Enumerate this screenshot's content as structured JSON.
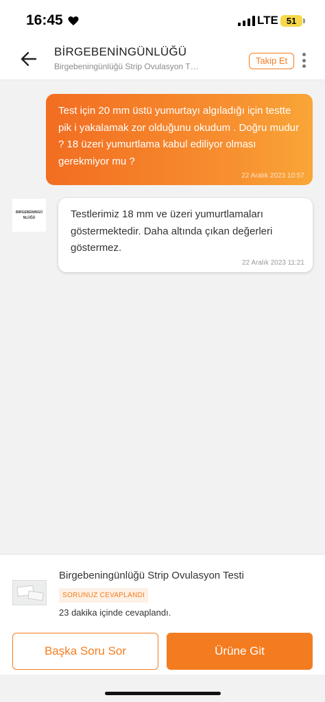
{
  "status_bar": {
    "time": "16:45",
    "network": "LTE",
    "battery": "51",
    "icons": [
      "heart-icon",
      "signal-icon",
      "battery-icon"
    ]
  },
  "header": {
    "title": "BİRGEBENİNGÜNLÜĞÜ",
    "subtitle": "Birgebeningünlüğü Strip Ovulasyon T…",
    "follow_label": "Takip Et",
    "icons": [
      "back-arrow-icon",
      "more-options-icon"
    ]
  },
  "messages": [
    {
      "sender": "user",
      "text": "Test için 20 mm üstü yumurtayı algıladığı için testte pik i yakalamak zor olduğunu okudum . Doğru mudur ? 18 üzeri yumurtlama kabul ediliyor olması gerekmiyor mu ?",
      "time": "22 Aralık 2023 10:57"
    },
    {
      "sender": "brand",
      "avatar_text": "BIRGEBENINGÜ NLÜĞÜ",
      "text": "Testlerimiz 18 mm ve üzeri yumurtlamaları göstermektedir. Daha altında çıkan değerleri göstermez.",
      "time": "22 Aralık 2023 11:21"
    }
  ],
  "product": {
    "name": "Birgebeningünlüğü Strip Ovulasyon Testi",
    "badge": "SORUNUZ CEVAPLANDI",
    "answer_time": "23 dakika içinde cevaplandı."
  },
  "actions": {
    "ask_label": "Başka Soru Sor",
    "go_label": "Ürüne Git"
  },
  "colors": {
    "accent": "#f47c20",
    "user_bubble_start": "#f26d21",
    "user_bubble_end": "#f9a637",
    "background": "#f2f2f2"
  }
}
